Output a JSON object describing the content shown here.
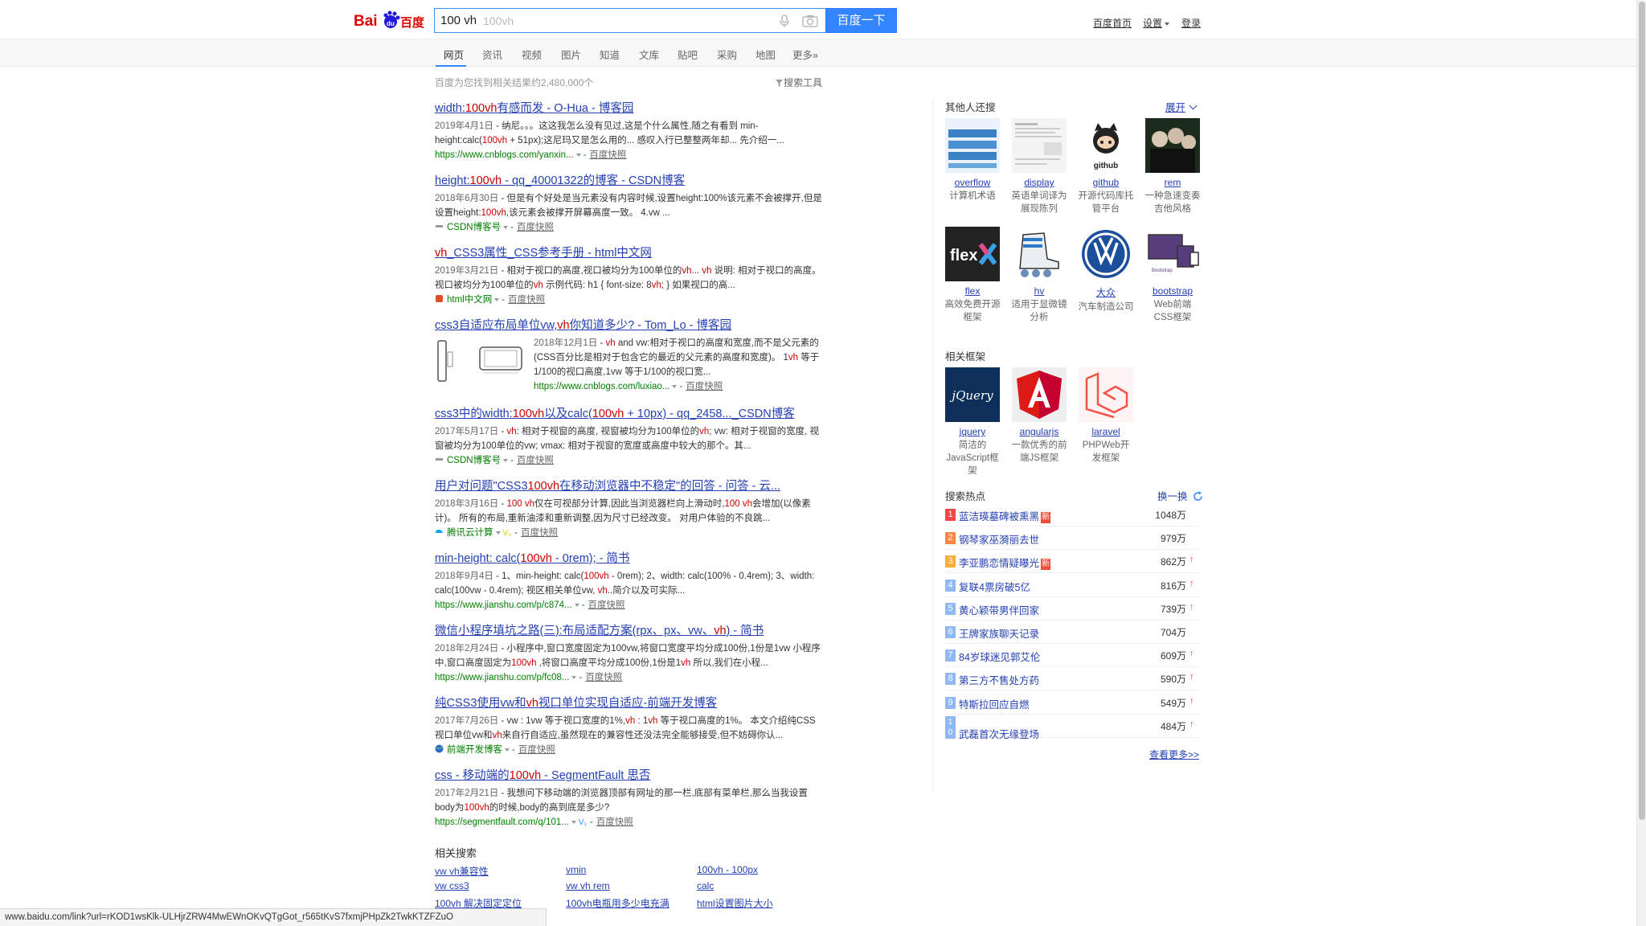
{
  "header": {
    "logo_text": "Bai百度",
    "search_value": "100 vh",
    "search_ghost": "100vh",
    "search_button": "百度一下",
    "links": {
      "home": "百度首页",
      "settings": "设置",
      "login": "登录"
    }
  },
  "tabs": [
    "网页",
    "资讯",
    "视频",
    "图片",
    "知道",
    "文库",
    "贴吧",
    "采购",
    "地图",
    "更多»"
  ],
  "stats": {
    "text": "百度为您找到相关结果约2,480,000个",
    "tools": "搜索工具"
  },
  "results": [
    {
      "title": "width:100vh有感而发 - O-Hua - 博客园",
      "date": "2019年4月1日",
      "abstract": " - 纳尼。。。这这我怎么没有见过,这是个什么属性,随之有看到 min-height:calc(100vh + 51px);这尼玛又是怎么用的... 感叹入行已整整两年却... 先介绍一...",
      "url": "https://www.cnblogs.com/yanxin...",
      "snapshot": "百度快照",
      "site": ""
    },
    {
      "title": "height:100vh - qq_40001322的博客 - CSDN博客",
      "date": "2018年6月30日",
      "abstract": " - 但是有个好处是当元素没有内容时候,设置height:100%该元素不会被撑开,但是设置height:100vh,该元素会被撑开屏幕高度一致。 4.vw ...",
      "url": "",
      "site": "CSDN博客号",
      "snapshot": "百度快照"
    },
    {
      "title": "vh_CSS3属性_CSS参考手册 - html中文网",
      "date": "2019年3月21日",
      "abstract": " - 相对于视口的高度,视口被均分为100单位的vh... vh 说明: 相对于视口的高度。视口被均分为100单位的vh 示例代码: h1 { font-size: 8vh; } 如果视口的高...",
      "url": "",
      "site": "html中文网",
      "snapshot": "百度快照"
    },
    {
      "title": "css3自适应布局单位vw,vh你知道多少? - Tom_Lo - 博客园",
      "date": "2018年12月1日",
      "abstract": " - vh and vw:相对于视口的高度和宽度,而不是父元素的(CSS百分比是相对于包含它的最近的父元素的高度和宽度)。 1vh 等于1/100的视口高度,1vw 等于1/100的视口宽...",
      "url": "https://www.cnblogs.com/luxiao...",
      "site": "",
      "snapshot": "百度快照"
    },
    {
      "title": "css3中的width:100vh以及calc(100vh + 10px) - qq_2458..._CSDN博客",
      "date": "2017年5月17日",
      "abstract": " - vh: 相对于视窗的高度, 视窗被均分为100单位的vh; vw: 相对于视窗的宽度, 视窗被均分为100单位的vw; vmax: 相对于视窗的宽度或高度中较大的那个。其...",
      "url": "",
      "site": "CSDN博客号",
      "snapshot": "百度快照"
    },
    {
      "title": "用户对问题\"CSS3100vh在移动浏览器中不稳定\"的回答 - 问答 - 云...",
      "date": "2018年3月16日",
      "abstract": " - 100 vh仅在可视部分计算,因此当浏览器栏向上滑动时,100 vh会增加(以像素计)。 所有的布局,重新油漆和重新调整,因为尺寸已经改变。 对用户体验的不良跳...",
      "url": "",
      "site": "腾讯云计算",
      "snapshot": "百度快照"
    },
    {
      "title": "min-height: calc(100vh - 0rem); - 简书",
      "date": "2018年9月4日",
      "abstract": " - 1、min-height: calc(100vh - 0rem); 2、width: calc(100% - 0.4rem); 3、width: calc(100vw - 0.4rem); 视区相关单位vw, vh..简介以及可实际...",
      "url": "https://www.jianshu.com/p/c874...",
      "site": "",
      "snapshot": "百度快照"
    },
    {
      "title": "微信小程序填坑之路(三):布局适配方案(rpx、px、vw、vh) - 简书",
      "date": "2018年2月24日",
      "abstract": " - 小程序中,窗口宽度固定为100vw,将窗口宽度平均分成100份,1份是1vw 小程序中,窗口高度固定为100vh ,将窗口高度平均分成100份,1份是1vh 所以,我们在小程...",
      "url": "https://www.jianshu.com/p/fc08...",
      "site": "",
      "snapshot": "百度快照"
    },
    {
      "title": "纯CSS3使用vw和vh视口单位实现自适应-前端开发博客",
      "date": "2017年7月26日",
      "abstract": " - vw : 1vw 等于视口宽度的1%,vh : 1vh 等于视口高度的1%。 本文介绍纯CSS视口单位vw和vh来自行自适应,虽然现在的兼容性还没法完全能够接受,但不妨碍你认...",
      "url": "",
      "site": "前端开发博客",
      "snapshot": "百度快照"
    },
    {
      "title": "css - 移动端的100vh - SegmentFault 思否",
      "date": "2017年2月21日",
      "abstract": " - 我想问下移动端的浏览器顶部有网址的那一栏,底部有菜单栏,那么当我设置body为100vh的时候,body的高到底是多少?",
      "url": "https://segmentfault.com/q/101...",
      "site": "",
      "snapshot": "百度快照"
    }
  ],
  "related": {
    "title": "相关搜索",
    "items": [
      "vw vh兼容性",
      "vmin",
      "100vh - 100px",
      "vw css3",
      "vw vh rem",
      "calc",
      "100vh 解决固定定位",
      "100vh电瓶用多少电充满",
      "html设置图片大小"
    ]
  },
  "status_url": "www.baidu.com/link?url=rKOD1wsKlk-ULHjrZRW4MwEWnOKvQTgGot_r565tKvS7fxmjPHpZk2TwkKTZFZuO",
  "right": {
    "others_title": "其他人还搜",
    "expand": "展开",
    "others": [
      {
        "name": "overflow",
        "desc": "计算机术语"
      },
      {
        "name": "display",
        "desc": "英语单词译为展现陈列"
      },
      {
        "name": "github",
        "desc": "开源代码库托管平台"
      },
      {
        "name": "rem",
        "desc": "一种急速变奏吉他风格"
      },
      {
        "name": "flex",
        "desc": "高效免费开源框架"
      },
      {
        "name": "hv",
        "desc": "适用于显微镜分析"
      },
      {
        "name": "大众",
        "desc": "汽车制造公司"
      },
      {
        "name": "bootstrap",
        "desc": "Web前端CSS框架"
      }
    ],
    "frameworks_title": "相关框架",
    "frameworks": [
      {
        "name": "jquery",
        "desc": "简洁的JavaScript框架"
      },
      {
        "name": "angularjs",
        "desc": "一款优秀的前端JS框架"
      },
      {
        "name": "laravel",
        "desc": "PHPWeb开发框架"
      }
    ],
    "hot_title": "搜索热点",
    "hot_refresh": "换一换",
    "hot": [
      {
        "rank": "1",
        "text": "蓝洁瑛墓碑被熏黑",
        "new": "新",
        "count": "1048万",
        "up": ""
      },
      {
        "rank": "2",
        "text": "钢琴家巫漪丽去世",
        "new": "",
        "count": "979万",
        "up": ""
      },
      {
        "rank": "3",
        "text": "李亚鹏恋情疑曝光",
        "new": "新",
        "count": "862万",
        "up": "↑"
      },
      {
        "rank": "4",
        "text": "复联4票房破5亿",
        "new": "",
        "count": "816万",
        "up": "↑"
      },
      {
        "rank": "5",
        "text": "黄心颖带男伴回家",
        "new": "",
        "count": "739万",
        "up": "↑"
      },
      {
        "rank": "6",
        "text": "王牌家族聊天记录",
        "new": "",
        "count": "704万",
        "up": ""
      },
      {
        "rank": "7",
        "text": "84岁球迷见郭艾伦",
        "new": "",
        "count": "609万",
        "up": "↑"
      },
      {
        "rank": "8",
        "text": "第三方不售处方药",
        "new": "",
        "count": "590万",
        "up": "↑"
      },
      {
        "rank": "9",
        "text": "特斯拉回应自燃",
        "new": "",
        "count": "549万",
        "up": "↑"
      },
      {
        "rank": "10",
        "text": "武磊首次无缘登场",
        "new": "",
        "count": "484万",
        "up": "↑"
      }
    ],
    "see_more": "查看更多>>"
  }
}
